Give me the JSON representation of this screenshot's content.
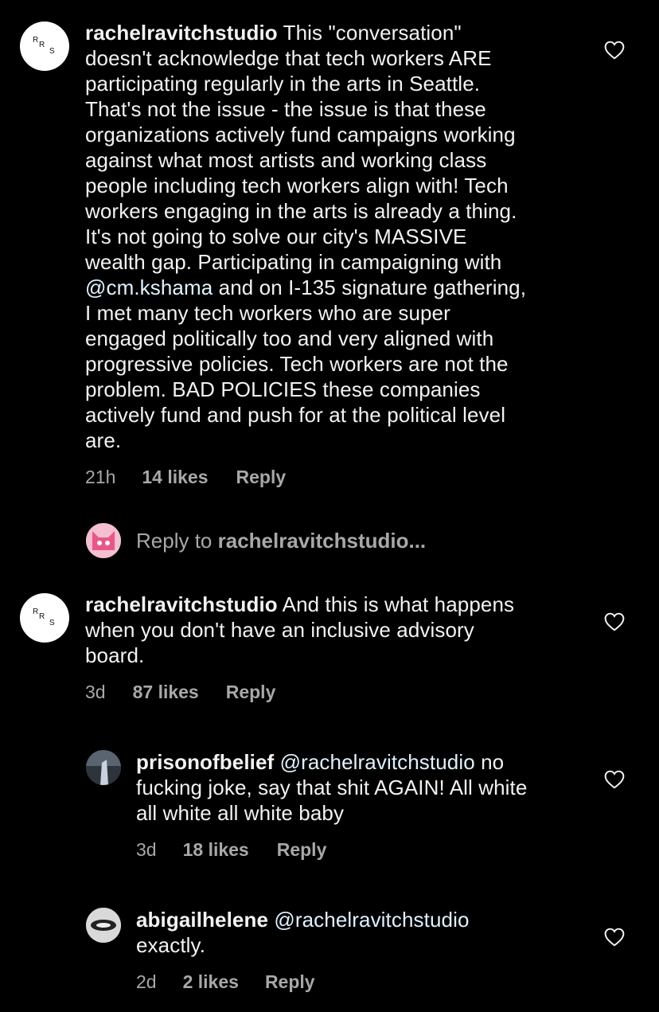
{
  "comments": [
    {
      "username": "rachelravitchstudio",
      "text_lines": [
        "This \"conversation\"",
        "doesn't acknowledge that tech workers ARE",
        "participating regularly in the arts in Seattle.",
        "That's not the issue - the issue is that these",
        "organizations actively fund campaigns working",
        "against what most artists and working class",
        "people including tech workers align with! Tech",
        "workers engaging in the arts is already a thing.",
        "It's not going to solve our city's MASSIVE",
        "wealth gap. Participating in campaigning with",
        "and on I-135 signature gathering,",
        "I met many tech workers who are super",
        "engaged politically too and very aligned with",
        "progressive policies. Tech workers are not the",
        "problem. BAD POLICIES these companies",
        "actively fund and push for at the political level",
        "are."
      ],
      "mention": "@cm.kshama",
      "time": "21h",
      "likes": "14 likes",
      "reply_label": "Reply"
    },
    {
      "username": "rachelravitchstudio",
      "text_lines": [
        "And this is what happens",
        "when you don't have an inclusive advisory",
        "board."
      ],
      "time": "3d",
      "likes": "87 likes",
      "reply_label": "Reply"
    },
    {
      "username": "prisonofbelief",
      "mention": "@rachelravitchstudio",
      "text_lines": [
        "no",
        "fucking joke, say that shit AGAIN! All white",
        "all white all white baby"
      ],
      "time": "3d",
      "likes": "18 likes",
      "reply_label": "Reply"
    },
    {
      "username": "abigailhelene",
      "mention": "@rachelravitchstudio",
      "text_lines": [
        "exactly."
      ],
      "time": "2d",
      "likes": "2 likes",
      "reply_label": "Reply"
    }
  ],
  "reply_to": {
    "prefix": "Reply to",
    "username": "rachelravitchstudio..."
  },
  "avatar_rrs_letters": [
    "R",
    "R",
    "S"
  ],
  "icons": {
    "like": "heart-outline-icon",
    "avatar_self": "pink-cat-avatar"
  },
  "colors": {
    "background": "#000000",
    "text": "#f2f2f2",
    "muted": "#a8a8a8",
    "mention": "#e0f1ff"
  }
}
